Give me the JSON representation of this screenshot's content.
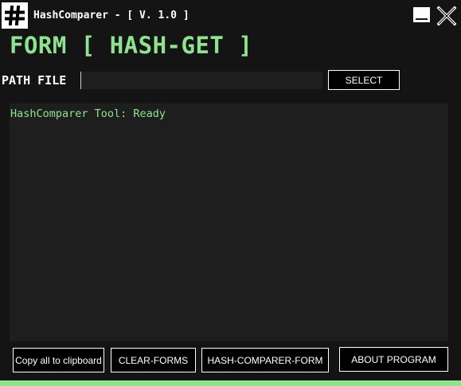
{
  "window": {
    "title": "HashComparer - [ V. 1.0 ]",
    "app_icon": "hash-icon",
    "minimize_icon": "minimize-icon",
    "close_icon": "close-icon"
  },
  "form": {
    "title": "FORM [ HASH-GET ]"
  },
  "path": {
    "label": "PATH FILE",
    "value": "",
    "select_label": "SELECT"
  },
  "output": {
    "text": "HashComparer Tool: Ready"
  },
  "buttons": {
    "copy_label": "Copy all to clipboard",
    "clear_label": "CLEAR-FORMS",
    "hash_comparer_label": "HASH-COMPARER-FORM",
    "about_label": "ABOUT PROGRAM"
  },
  "colors": {
    "background": "#141414",
    "panel": "#1e1e1e",
    "accent": "#8fe38f",
    "text": "#ffffff"
  }
}
